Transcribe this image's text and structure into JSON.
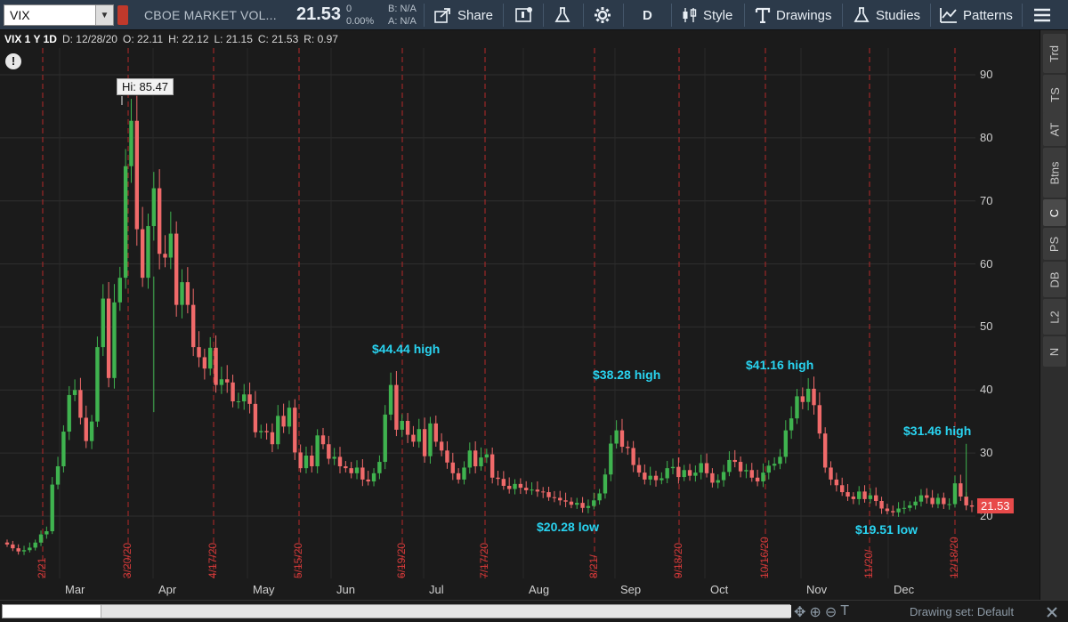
{
  "toolbar": {
    "symbol": "VIX",
    "description": "CBOE MARKET VOL...",
    "last_price": "21.53",
    "change": "0",
    "change_pct": "0.00%",
    "bid": "B: N/A",
    "ask": "A: N/A",
    "share_label": "Share",
    "aggregation": "D",
    "style_label": "Style",
    "drawings_label": "Drawings",
    "studies_label": "Studies",
    "patterns_label": "Patterns"
  },
  "infobar": {
    "title": "VIX 1 Y 1D",
    "date": "D: 12/28/20",
    "open": "O: 22.11",
    "high": "H: 22.12",
    "low": "L: 21.15",
    "close": "C: 21.53",
    "range": "R: 0.97"
  },
  "side_tabs": [
    "Trd",
    "TS",
    "AT",
    "Btns",
    "C",
    "PS",
    "DB",
    "L2",
    "N"
  ],
  "active_tab": "C",
  "bottom": {
    "drawing_set": "Drawing set: Default"
  },
  "chart_data": {
    "type": "candlestick",
    "yticks": [
      20,
      30,
      40,
      50,
      60,
      70,
      80,
      90
    ],
    "ylim": [
      11,
      94
    ],
    "months": [
      "Mar",
      "Apr",
      "May",
      "Jun",
      "Jul",
      "Aug",
      "Sep",
      "Oct",
      "Nov",
      "Dec"
    ],
    "expiration_dates": [
      "2/21",
      "3/20/20",
      "4/17/20",
      "5/15/20",
      "6/19/20",
      "7/17/20",
      "8/21/",
      "9/18/20",
      "10/16/20",
      "11/20/",
      "12/18/20"
    ],
    "annotations": [
      {
        "text": "Hi: 85.47",
        "value": 85.47
      },
      {
        "text": "$44.44 high",
        "value": 44.44
      },
      {
        "text": "$20.28 low",
        "value": 20.28
      },
      {
        "text": "$38.28 high",
        "value": 38.28
      },
      {
        "text": "$41.16 high",
        "value": 41.16
      },
      {
        "text": "$19.51 low",
        "value": 19.51
      },
      {
        "text": "$31.46 high",
        "value": 31.46
      }
    ],
    "last_price_label": "21.53",
    "colors": {
      "up": "#3fb34f",
      "down": "#f06a6a",
      "expiry_line": "#b52a2a",
      "annotation": "#29d3f0",
      "price_tag": "#e84a4a"
    },
    "closes": [
      15.5,
      14.9,
      14.4,
      14.6,
      15.0,
      15.8,
      17.1,
      17.6,
      25.0,
      27.9,
      33.4,
      39.2,
      40.0,
      35.6,
      31.9,
      35.0,
      46.8,
      54.5,
      41.9,
      53.9,
      57.8,
      75.5,
      82.7,
      65.5,
      57.8,
      66.0,
      72.0,
      61.6,
      61.0,
      64.8,
      53.5,
      57.1,
      53.5,
      46.8,
      45.2,
      43.4,
      46.7,
      40.8,
      41.7,
      41.2,
      38.2,
      38.2,
      39.3,
      37.8,
      33.3,
      33.5,
      33.3,
      31.4,
      35.9,
      34.2,
      37.2,
      30.1,
      27.6,
      29.6,
      27.9,
      32.8,
      31.4,
      29.1,
      29.4,
      27.9,
      27.6,
      26.8,
      27.7,
      25.8,
      25.5,
      26.8,
      28.6,
      36.1,
      40.8,
      33.7,
      35.1,
      32.9,
      31.8,
      33.8,
      29.5,
      34.7,
      31.8,
      30.4,
      28.5,
      26.8,
      25.8,
      27.7,
      30.4,
      27.9,
      29.3,
      29.8,
      26.1,
      25.9,
      24.8,
      24.3,
      25.1,
      24.5,
      24.1,
      24.2,
      23.9,
      23.8,
      23.0,
      22.9,
      22.5,
      22.3,
      21.8,
      22.1,
      21.3,
      21.6,
      22.5,
      23.6,
      26.6,
      31.5,
      33.6,
      31.0,
      30.8,
      28.1,
      26.9,
      25.8,
      26.4,
      25.7,
      26.0,
      27.6,
      27.8,
      26.2,
      27.3,
      26.4,
      26.9,
      28.4,
      26.8,
      25.3,
      25.7,
      27.0,
      28.9,
      28.6,
      27.1,
      27.3,
      26.1,
      25.5,
      26.9,
      28.0,
      28.3,
      29.4,
      33.6,
      35.5,
      39.0,
      38.1,
      40.2,
      37.6,
      33.1,
      27.7,
      25.8,
      24.9,
      23.8,
      23.1,
      22.7,
      23.9,
      22.7,
      23.3,
      22.4,
      21.2,
      20.8,
      20.6,
      21.2,
      21.3,
      21.7,
      22.3,
      23.3,
      22.9,
      21.9,
      22.9,
      21.9,
      21.9,
      25.2,
      23.1,
      21.7,
      21.5
    ]
  }
}
